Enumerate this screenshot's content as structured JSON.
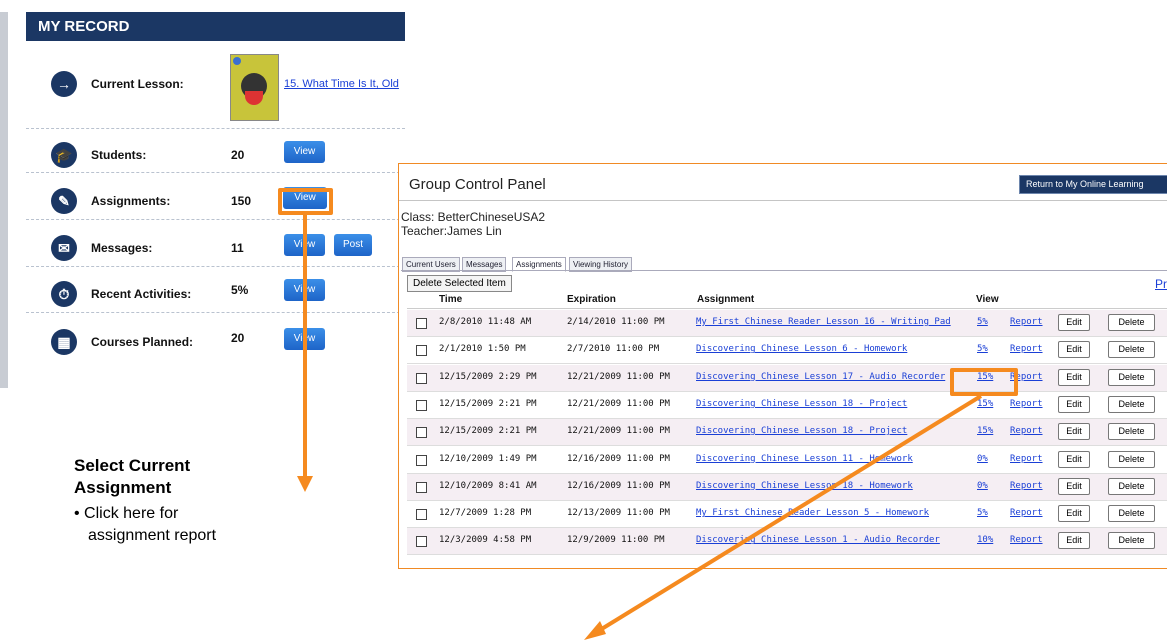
{
  "record": {
    "header": "MY RECORD",
    "current_lesson": {
      "label": "Current Lesson:",
      "link": "15. What Time Is It, Old"
    },
    "rows": [
      {
        "label": "Students:",
        "count": "20",
        "buttons": [
          "View"
        ]
      },
      {
        "label": "Assignments:",
        "count": "150",
        "buttons": [
          "View"
        ]
      },
      {
        "label": "Messages:",
        "count": "11",
        "buttons": [
          "View",
          "Post"
        ]
      },
      {
        "label": "Recent Activities:",
        "count": "5%",
        "buttons": [
          "View"
        ]
      },
      {
        "label": "Courses Planned:",
        "count": "20",
        "buttons": [
          "View"
        ]
      }
    ]
  },
  "caption": {
    "title_line1": "Select Current",
    "title_line2": "Assignment",
    "bullet_line1": "• Click here for",
    "bullet_line2": "assignment report"
  },
  "panel": {
    "title": "Group Control Panel",
    "return_button": "Return to My Online Learning",
    "class_line": "Class:  BetterChineseUSA2",
    "teacher_line": "Teacher:James Lin",
    "tabs": [
      "Current Users",
      "Messages",
      "Assignments",
      "Viewing History"
    ],
    "active_tab": "Assignments",
    "delete_selected": "Delete Selected Item",
    "print_link": "Prin",
    "columns": [
      "Time",
      "Expiration",
      "Assignment",
      "View"
    ],
    "edit_label": "Edit",
    "delete_label": "Delete",
    "report_label": "Report",
    "rows": [
      {
        "time": "2/8/2010 11:48 AM",
        "expiration": "2/14/2010 11:00 PM",
        "assignment": "My First Chinese Reader Lesson 16 - Writing Pad",
        "view": "5%"
      },
      {
        "time": "2/1/2010 1:50 PM",
        "expiration": "2/7/2010 11:00 PM",
        "assignment": "Discovering Chinese Lesson 6 - Homework",
        "view": "5%"
      },
      {
        "time": "12/15/2009 2:29 PM",
        "expiration": "12/21/2009 11:00 PM",
        "assignment": "Discovering Chinese Lesson 17 - Audio Recorder",
        "view": "15%"
      },
      {
        "time": "12/15/2009 2:21 PM",
        "expiration": "12/21/2009 11:00 PM",
        "assignment": "Discovering Chinese Lesson 18 - Project",
        "view": "15%"
      },
      {
        "time": "12/15/2009 2:21 PM",
        "expiration": "12/21/2009 11:00 PM",
        "assignment": "Discovering Chinese Lesson 18 - Project",
        "view": "15%"
      },
      {
        "time": "12/10/2009 1:49 PM",
        "expiration": "12/16/2009 11:00 PM",
        "assignment": "Discovering Chinese Lesson 11 - Homework",
        "view": "0%"
      },
      {
        "time": "12/10/2009 8:41 AM",
        "expiration": "12/16/2009 11:00 PM",
        "assignment": "Discovering Chinese Lesson 18 - Homework",
        "view": "0%"
      },
      {
        "time": "12/7/2009 1:28 PM",
        "expiration": "12/13/2009 11:00 PM",
        "assignment": "My First Chinese Reader Lesson 5 - Homework",
        "view": "5%"
      },
      {
        "time": "12/3/2009 4:58 PM",
        "expiration": "12/9/2009 11:00 PM",
        "assignment": "Discovering Chinese Lesson 1 - Audio Recorder",
        "view": "10%"
      }
    ]
  },
  "colors": {
    "navy": "#1b3764",
    "button_blue": "#2f7fdc",
    "highlight_orange": "#f58a1f",
    "row_alt": "#f5eef3"
  }
}
